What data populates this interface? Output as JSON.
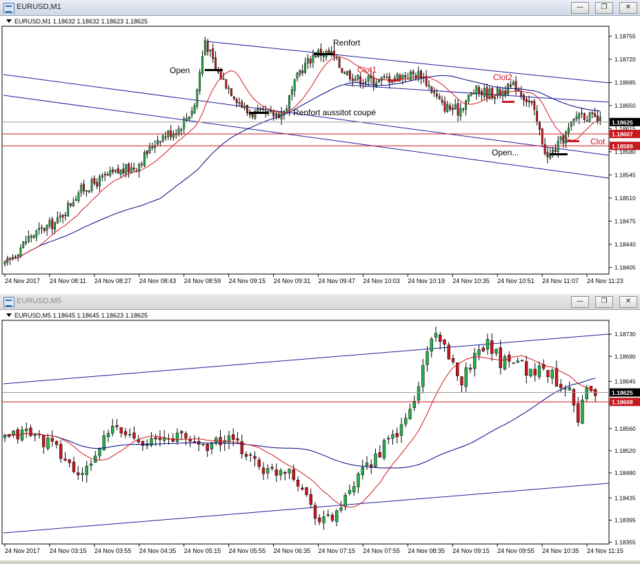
{
  "colors": {
    "up": "#24b14a",
    "down": "#c8181e",
    "ma_fast": "#d0181e",
    "ma_slow": "#000080",
    "trend": "#1d1d9e",
    "hline_red": "#c8181e",
    "hline_gray": "#9a9a9a",
    "bid_bg": "#000000",
    "mark_bg": "#c8181e"
  },
  "chart_data": [
    {
      "type": "candlestick",
      "window_title": "EURUSD,M1",
      "header": "EURUSD,M1  1.18632 1.18632 1.18623 1.18625",
      "ylim": [
        1.18395,
        1.1877
      ],
      "y_ticks": [
        "1.18755",
        "1.18720",
        "1.18685",
        "1.18650",
        "1.18615",
        "1.18580",
        "1.18545",
        "1.18510",
        "1.18475",
        "1.18440",
        "1.18405"
      ],
      "price_markers": [
        {
          "label": "1.18625",
          "value": 1.18625,
          "style": "black"
        },
        {
          "label": "1.18607",
          "value": 1.18607,
          "style": "red"
        },
        {
          "label": "1.18589",
          "value": 1.18589,
          "style": "red"
        }
      ],
      "x_ticks": [
        "24 Nov 2017",
        "24 Nov 08:11",
        "24 Nov 08:27",
        "24 Nov 08:43",
        "24 Nov 08:59",
        "24 Nov 09:15",
        "24 Nov 09:31",
        "24 Nov 09:47",
        "24 Nov 10:03",
        "24 Nov 10:19",
        "24 Nov 10:35",
        "24 Nov 10:51",
        "24 Nov 11:07",
        "24 Nov 11:23"
      ],
      "annotations": [
        {
          "text": "Open",
          "color": "#000000"
        },
        {
          "text": "Renfort",
          "color": "#000000"
        },
        {
          "text": "Clot1",
          "color": "#c8181e"
        },
        {
          "text": "Clot2",
          "color": "#c8181e"
        },
        {
          "text": "Renfort aussitot coupé",
          "color": "#000000"
        },
        {
          "text": "Open...",
          "color": "#000000"
        },
        {
          "text": "Clot",
          "color": "#c8181e"
        }
      ],
      "control_points": [
        [
          0,
          1.18408
        ],
        [
          9,
          1.1845
        ],
        [
          14,
          1.18462
        ],
        [
          20,
          1.18475
        ],
        [
          28,
          1.1852
        ],
        [
          40,
          1.18545
        ],
        [
          50,
          1.18558
        ],
        [
          58,
          1.186
        ],
        [
          66,
          1.18615
        ],
        [
          72,
          1.1865
        ],
        [
          76,
          1.1875
        ],
        [
          80,
          1.18705
        ],
        [
          86,
          1.18672
        ],
        [
          92,
          1.1864
        ],
        [
          100,
          1.18635
        ],
        [
          106,
          1.1864
        ],
        [
          112,
          1.18702
        ],
        [
          118,
          1.1873
        ],
        [
          124,
          1.18728
        ],
        [
          128,
          1.18705
        ],
        [
          134,
          1.1869
        ],
        [
          142,
          1.18688
        ],
        [
          150,
          1.18695
        ],
        [
          158,
          1.18698
        ],
        [
          166,
          1.1865
        ],
        [
          172,
          1.18642
        ],
        [
          178,
          1.18672
        ],
        [
          186,
          1.18668
        ],
        [
          194,
          1.1868
        ],
        [
          200,
          1.1865
        ],
        [
          206,
          1.1857
        ],
        [
          212,
          1.186
        ],
        [
          218,
          1.1864
        ],
        [
          226,
          1.18625
        ]
      ]
    },
    {
      "type": "candlestick",
      "window_title": "EURUSD,M5",
      "header": "EURUSD,M5  1.18645 1.18645 1.18623 1.18625",
      "ylim": [
        1.18352,
        1.18755
      ],
      "y_ticks": [
        "1.18730",
        "1.18690",
        "1.18645",
        "1.18605",
        "1.18560",
        "1.18520",
        "1.18480",
        "1.18435",
        "1.18395",
        "1.18355"
      ],
      "price_markers": [
        {
          "label": "1.18625",
          "value": 1.18625,
          "style": "black"
        },
        {
          "label": "1.18608",
          "value": 1.18608,
          "style": "red"
        }
      ],
      "x_ticks": [
        "24 Nov 2017",
        "24 Nov 03:15",
        "24 Nov 03:55",
        "24 Nov 04:35",
        "24 Nov 05:15",
        "24 Nov 05:55",
        "24 Nov 06:35",
        "24 Nov 07:15",
        "24 Nov 07:55",
        "24 Nov 08:35",
        "24 Nov 09:15",
        "24 Nov 09:55",
        "24 Nov 10:35",
        "24 Nov 11:15"
      ],
      "control_points": [
        [
          0,
          1.1854
        ],
        [
          5,
          1.18555
        ],
        [
          11,
          1.1853
        ],
        [
          15,
          1.18495
        ],
        [
          18,
          1.1847
        ],
        [
          21,
          1.18515
        ],
        [
          25,
          1.1856
        ],
        [
          30,
          1.18545
        ],
        [
          35,
          1.18535
        ],
        [
          40,
          1.18548
        ],
        [
          46,
          1.1853
        ],
        [
          52,
          1.1854
        ],
        [
          57,
          1.1851
        ],
        [
          61,
          1.1848
        ],
        [
          66,
          1.1849
        ],
        [
          70,
          1.1844
        ],
        [
          73,
          1.18395
        ],
        [
          76,
          1.184
        ],
        [
          79,
          1.1843
        ],
        [
          83,
          1.1848
        ],
        [
          87,
          1.1852
        ],
        [
          92,
          1.1856
        ],
        [
          95,
          1.1861
        ],
        [
          98,
          1.187
        ],
        [
          100,
          1.1874
        ],
        [
          103,
          1.1868
        ],
        [
          106,
          1.1865
        ],
        [
          109,
          1.1869
        ],
        [
          112,
          1.1872
        ],
        [
          115,
          1.1868
        ],
        [
          118,
          1.1869
        ],
        [
          122,
          1.1866
        ],
        [
          125,
          1.1867
        ],
        [
          129,
          1.1864
        ],
        [
          131,
          1.1864
        ],
        [
          133,
          1.1858
        ],
        [
          135,
          1.1863
        ],
        [
          137,
          1.18625
        ]
      ]
    }
  ]
}
